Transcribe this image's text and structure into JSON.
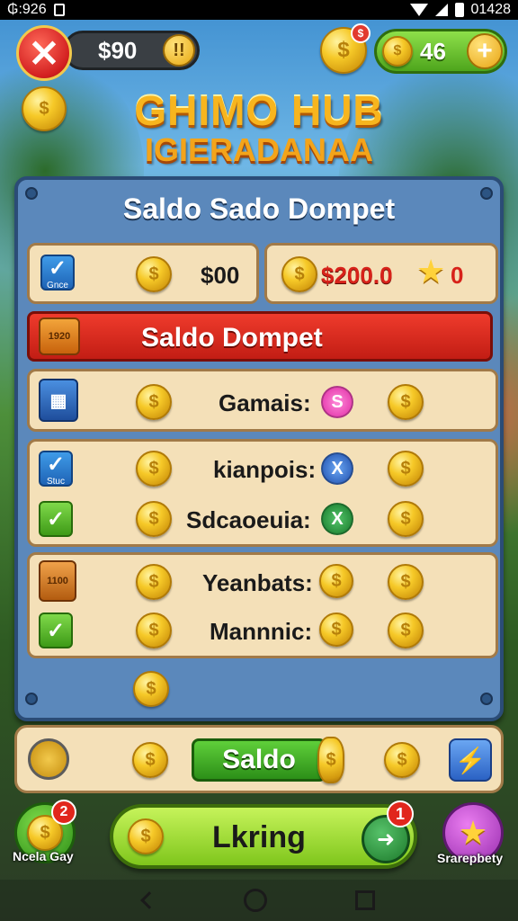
{
  "status_bar": {
    "left_text": "₲:926",
    "time": "01428"
  },
  "top_bar": {
    "money": "$90",
    "alert": "!!",
    "coin_badge": "$",
    "coin_count": "46",
    "plus": "+"
  },
  "title": {
    "line1": "GHIMO HUB",
    "line2": "IGIERADANAA"
  },
  "panel": {
    "title": "Saldo Sado Dompet",
    "left_card": {
      "check_label": "Gnce",
      "value": "$00"
    },
    "right_card": {
      "value": "$200.0",
      "suffix": "0"
    },
    "banner": {
      "label": "Saldo Dompet",
      "box_text": "1920"
    },
    "rows": [
      {
        "label": "Gamais:",
        "gem_symbol": "S"
      },
      {
        "label": "kianpois:",
        "check_label": "Stuc",
        "gem_symbol": "X"
      },
      {
        "label": "Sdcaoeuia:",
        "gem_symbol": "X"
      },
      {
        "label": "Yeanbats:",
        "box_text": "1100"
      },
      {
        "label": "Mannnic:"
      }
    ]
  },
  "bottom_bar": {
    "saldo_button": "Saldo"
  },
  "actions": {
    "lkring_button": "Lkring",
    "lkring_badge": "1",
    "left_badge": "2",
    "left_label": "Ncela Gay",
    "right_label": "Srarepbety"
  },
  "colors": {
    "panel_blue": "#5b88bb",
    "banner_red": "#d42a1f",
    "accent_green": "#4ea51c",
    "coin_gold": "#f6c928"
  }
}
